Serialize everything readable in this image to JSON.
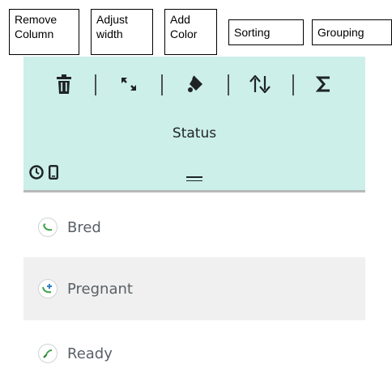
{
  "callouts": {
    "remove_column": "Remove\nColumn",
    "adjust_width": "Adjust\nwidth",
    "add_color": "Add\nColor",
    "sorting": "Sorting",
    "grouping": "Grouping"
  },
  "toolbar": {
    "icons": [
      "trash-icon",
      "resize-icon",
      "paint-bucket-icon",
      "sort-icon",
      "sigma-icon"
    ]
  },
  "column": {
    "title": "Status",
    "header_icons": [
      "clock-icon",
      "mobile-icon",
      "drag-handle-icon"
    ]
  },
  "rows": [
    {
      "label": "Bred",
      "icon": "bred-status-icon"
    },
    {
      "label": "Pregnant",
      "icon": "pregnant-status-icon"
    },
    {
      "label": "Ready",
      "icon": "ready-status-icon"
    }
  ],
  "colors": {
    "header_bg": "#ccefe9",
    "alt_row_bg": "#f0f0f0",
    "icon_green": "#3fa24a",
    "icon_blue": "#2f7fc4",
    "text_dark": "#1f2326",
    "text_gray": "#5a6066"
  }
}
